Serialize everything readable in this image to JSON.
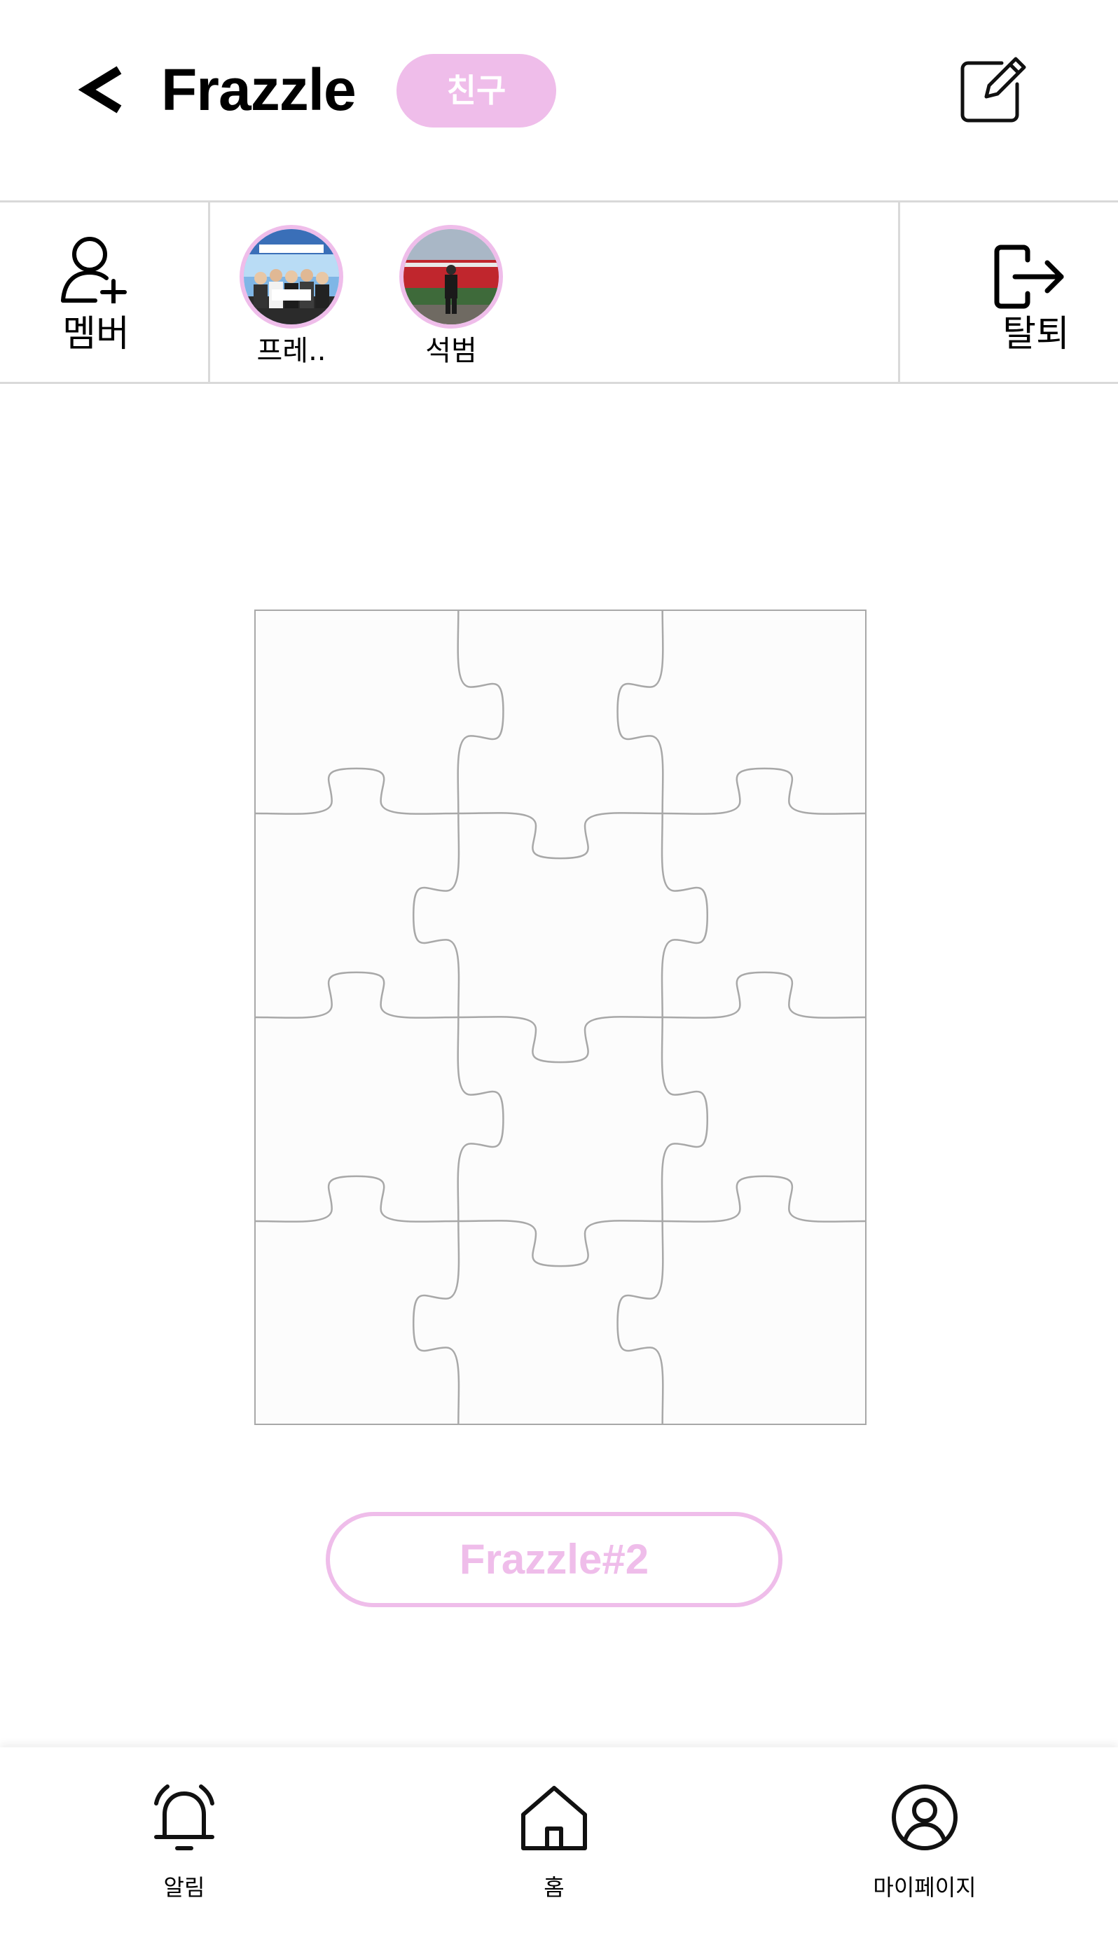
{
  "header": {
    "back_label": "<",
    "title": "Frazzle",
    "tag": "친구"
  },
  "members": {
    "member_label": "멤버",
    "leave_label": "탈퇴",
    "list": [
      {
        "name": "프레.."
      },
      {
        "name": "석범"
      }
    ]
  },
  "main": {
    "puzzle_rows": 4,
    "puzzle_cols": 3,
    "frazzle_button": "Frazzle#2"
  },
  "tabbar": {
    "items": [
      {
        "label": "알림",
        "icon": "bell-icon"
      },
      {
        "label": "홈",
        "icon": "home-icon"
      },
      {
        "label": "마이페이지",
        "icon": "user-circle-icon"
      }
    ]
  },
  "colors": {
    "accent_pink": "#efbdea",
    "divider": "#d9d9d9",
    "puzzle_line": "#a8a8a8",
    "puzzle_fill": "#fcfcfc"
  }
}
